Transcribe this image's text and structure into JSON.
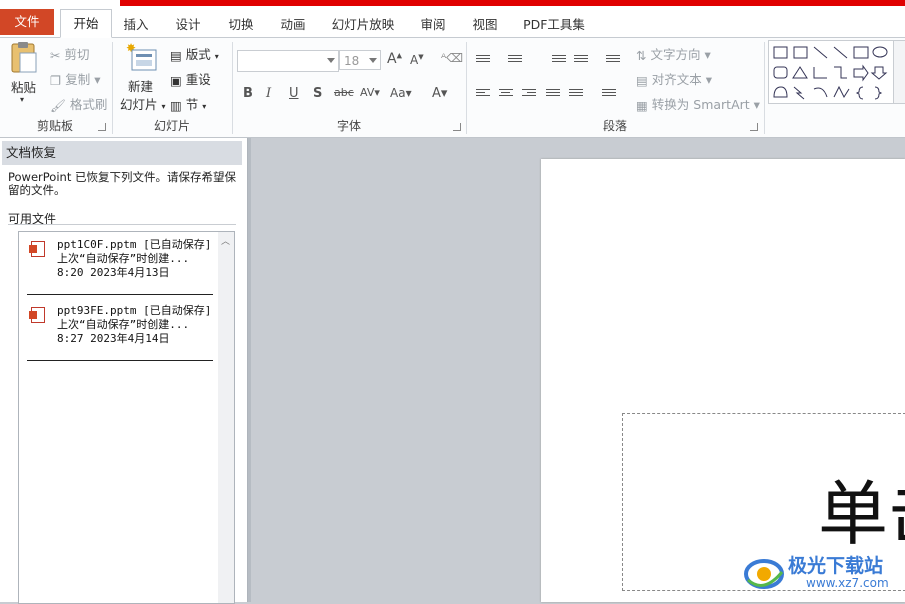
{
  "tabs": {
    "file": "文件",
    "home": "开始",
    "insert": "插入",
    "design": "设计",
    "transitions": "切换",
    "animations": "动画",
    "slideshow": "幻灯片放映",
    "review": "审阅",
    "view": "视图",
    "pdf": "PDF工具集"
  },
  "ribbon": {
    "clipboard": {
      "paste": "粘贴",
      "cut": "剪切",
      "copy": "复制",
      "format_painter": "格式刷",
      "label": "剪贴板"
    },
    "slides": {
      "new_slide_line1": "新建",
      "new_slide_line2": "幻灯片",
      "layout": "版式",
      "reset": "重设",
      "section": "节",
      "label": "幻灯片"
    },
    "font": {
      "font_name": "",
      "font_size": "18",
      "label": "字体"
    },
    "paragraph": {
      "text_direction": "文字方向",
      "align_text": "对齐文本",
      "convert_smartart": "转换为 SmartArt",
      "label": "段落"
    }
  },
  "recovery": {
    "title": "文档恢复",
    "message": "PowerPoint 已恢复下列文件。请保存希望保留的文件。",
    "available_label": "可用文件",
    "files": [
      {
        "name": "ppt1C0F.pptm  [已自动保存]",
        "desc": "上次“自动保存”时创建...",
        "time": "8:20 2023年4月13日"
      },
      {
        "name": "ppt93FE.pptm  [已自动保存]",
        "desc": "上次“自动保存”时创建...",
        "time": "8:27 2023年4月14日"
      }
    ]
  },
  "slide": {
    "title_partial": "单击"
  },
  "watermark": {
    "name": "极光下载站",
    "url": "www.xz7.com"
  },
  "colors": {
    "file_tab": "#d24726",
    "top_strip": "#e00000",
    "watermark": "#3a7bd5"
  }
}
